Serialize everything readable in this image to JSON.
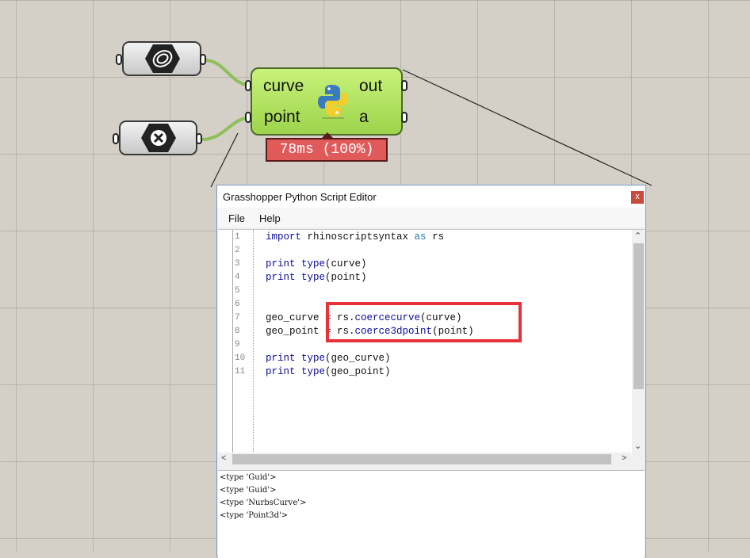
{
  "canvas": {
    "curve_param_icon": "curve-spiral-icon",
    "point_param_icon": "point-x-icon"
  },
  "component": {
    "input1": "curve",
    "input2": "point",
    "output1": "out",
    "output2": "a",
    "icon": "python-logo-icon",
    "runtime": "78ms (100%)",
    "color": "#b4e45e",
    "runtime_color": "#e05a5a"
  },
  "editor": {
    "title": "Grasshopper Python Script Editor",
    "close_label": "x",
    "menu": [
      "File",
      "Help"
    ],
    "line_numbers": [
      "1",
      "2",
      "3",
      "4",
      "5",
      "6",
      "7",
      "8",
      "9",
      "10",
      "11"
    ],
    "output_lines": [
      "<type 'Guid'>",
      "<type 'Guid'>",
      "<type 'NurbsCurve'>",
      "<type 'Point3d'>"
    ],
    "highlight_color": "#e8323a"
  },
  "code": {
    "l1_import": "import",
    "l1_module": " rhinoscriptsyntax ",
    "l1_as": "as",
    "l1_alias": " rs",
    "l3_print": "print",
    "l3_type": "type",
    "l3_arg": "(curve)",
    "l4_print": "print",
    "l4_type": "type",
    "l4_arg": "(point)",
    "l7_var": "geo_curve = rs.",
    "l7_func": "coercecurve",
    "l7_arg": "(curve)",
    "l8_var": "geo_point = rs.",
    "l8_func": "coerce3dpoint",
    "l8_arg": "(point)",
    "l10_print": "print",
    "l10_type": "type",
    "l10_arg": "(geo_curve)",
    "l11_print": "print",
    "l11_type": "type",
    "l11_arg": "(geo_point)"
  }
}
